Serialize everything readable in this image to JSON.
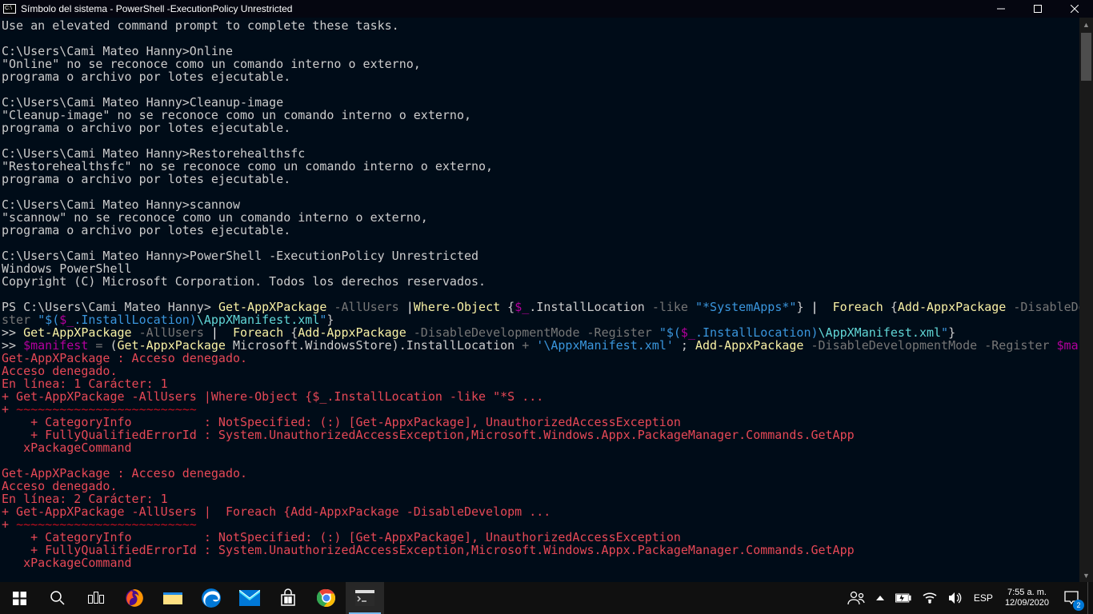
{
  "titlebar": {
    "title": "Símbolo del sistema - PowerShell  -ExecutionPolicy Unrestricted"
  },
  "taskbar": {
    "time": "7:55 a. m.",
    "date": "12/09/2020",
    "language": "ESP",
    "notif_count": "2"
  },
  "console": {
    "lines": [
      [
        [
          "gray",
          "Use an elevated command prompt to complete these tasks."
        ]
      ],
      [
        [
          "gray",
          ""
        ]
      ],
      [
        [
          "gray",
          "C:\\Users\\Cami Mateo Hanny>Online"
        ]
      ],
      [
        [
          "gray",
          "\"Online\" no se reconoce como un comando interno o externo,"
        ]
      ],
      [
        [
          "gray",
          "programa o archivo por lotes ejecutable."
        ]
      ],
      [
        [
          "gray",
          ""
        ]
      ],
      [
        [
          "gray",
          "C:\\Users\\Cami Mateo Hanny>Cleanup-image"
        ]
      ],
      [
        [
          "gray",
          "\"Cleanup-image\" no se reconoce como un comando interno o externo,"
        ]
      ],
      [
        [
          "gray",
          "programa o archivo por lotes ejecutable."
        ]
      ],
      [
        [
          "gray",
          ""
        ]
      ],
      [
        [
          "gray",
          "C:\\Users\\Cami Mateo Hanny>Restorehealthsfc"
        ]
      ],
      [
        [
          "gray",
          "\"Restorehealthsfc\" no se reconoce como un comando interno o externo,"
        ]
      ],
      [
        [
          "gray",
          "programa o archivo por lotes ejecutable."
        ]
      ],
      [
        [
          "gray",
          ""
        ]
      ],
      [
        [
          "gray",
          "C:\\Users\\Cami Mateo Hanny>scannow"
        ]
      ],
      [
        [
          "gray",
          "\"scannow\" no se reconoce como un comando interno o externo,"
        ]
      ],
      [
        [
          "gray",
          "programa o archivo por lotes ejecutable."
        ]
      ],
      [
        [
          "gray",
          ""
        ]
      ],
      [
        [
          "gray",
          "C:\\Users\\Cami Mateo Hanny>PowerShell -ExecutionPolicy Unrestricted"
        ]
      ],
      [
        [
          "gray",
          "Windows PowerShell"
        ]
      ],
      [
        [
          "gray",
          "Copyright (C) Microsoft Corporation. Todos los derechos reservados."
        ]
      ],
      [
        [
          "gray",
          ""
        ]
      ],
      [
        [
          "gray",
          "PS C:\\Users\\Cami Mateo Hanny> "
        ],
        [
          "yellow",
          "Get-AppXPackage"
        ],
        [
          "gray",
          " "
        ],
        [
          "darkgray",
          "-AllUsers"
        ],
        [
          "gray",
          " "
        ],
        [
          "white",
          "|"
        ],
        [
          "yellow",
          "Where-Object"
        ],
        [
          "gray",
          " {"
        ],
        [
          "magenta",
          "$_"
        ],
        [
          "gray",
          ".InstallLocation "
        ],
        [
          "darkgray",
          "-like"
        ],
        [
          "gray",
          " "
        ],
        [
          "darkcyan",
          "\"*SystemApps*\""
        ],
        [
          "gray",
          "} "
        ],
        [
          "white",
          "|"
        ],
        [
          "gray",
          " "
        ],
        [
          "yellow",
          " Foreach"
        ],
        [
          "gray",
          " {"
        ],
        [
          "yellow",
          "Add-AppxPackage"
        ],
        [
          "gray",
          " "
        ],
        [
          "darkgray",
          "-DisableDevelopmentMode -Regi"
        ]
      ],
      [
        [
          "darkgray",
          "ster "
        ],
        [
          "darkcyan",
          "\"$("
        ],
        [
          "magenta",
          "$_"
        ],
        [
          "darkcyan",
          ".InstallLocation)"
        ],
        [
          "cyan",
          "\\AppXManifest.xml"
        ],
        [
          "darkcyan",
          "\""
        ],
        [
          "gray",
          "}"
        ]
      ],
      [
        [
          "gray",
          ">> "
        ],
        [
          "yellow",
          "Get-AppXPackage"
        ],
        [
          "gray",
          " "
        ],
        [
          "darkgray",
          "-AllUsers"
        ],
        [
          "gray",
          " "
        ],
        [
          "white",
          "|"
        ],
        [
          "gray",
          " "
        ],
        [
          "yellow",
          " Foreach"
        ],
        [
          "gray",
          " {"
        ],
        [
          "yellow",
          "Add-AppxPackage"
        ],
        [
          "gray",
          " "
        ],
        [
          "darkgray",
          "-DisableDevelopmentMode -Register "
        ],
        [
          "darkcyan",
          "\"$("
        ],
        [
          "magenta",
          "$_"
        ],
        [
          "darkcyan",
          ".InstallLocation)"
        ],
        [
          "cyan",
          "\\AppXManifest.xml"
        ],
        [
          "darkcyan",
          "\""
        ],
        [
          "gray",
          "}"
        ]
      ],
      [
        [
          "gray",
          ">> "
        ],
        [
          "magenta",
          "$manifest"
        ],
        [
          "gray",
          " "
        ],
        [
          "darkgray",
          "="
        ],
        [
          "gray",
          " ("
        ],
        [
          "yellow",
          "Get-AppxPackage"
        ],
        [
          "gray",
          " Microsoft.WindowsStore).InstallLocation "
        ],
        [
          "darkgray",
          "+"
        ],
        [
          "gray",
          " "
        ],
        [
          "darkcyan",
          "'\\AppxManifest.xml'"
        ],
        [
          "gray",
          " ; "
        ],
        [
          "yellow",
          "Add-AppxPackage"
        ],
        [
          "gray",
          " "
        ],
        [
          "darkgray",
          "-DisableDevelopmentMode -Register "
        ],
        [
          "magenta",
          "$manifest"
        ]
      ],
      [
        [
          "red",
          "Get-AppXPackage : Acceso denegado."
        ]
      ],
      [
        [
          "red",
          "Acceso denegado."
        ]
      ],
      [
        [
          "red",
          "En línea: 1 Carácter: 1"
        ]
      ],
      [
        [
          "red",
          "+ Get-AppXPackage -AllUsers |Where-Object {$_.InstallLocation -like \"*S ..."
        ]
      ],
      [
        [
          "red",
          "+ "
        ],
        [
          "darkred",
          "~~~~~~~~~~~~~~~~~~~~~~~~~"
        ]
      ],
      [
        [
          "red",
          "    + CategoryInfo          : NotSpecified: (:) [Get-AppxPackage], UnauthorizedAccessException"
        ]
      ],
      [
        [
          "red",
          "    + FullyQualifiedErrorId : System.UnauthorizedAccessException,Microsoft.Windows.Appx.PackageManager.Commands.GetApp"
        ]
      ],
      [
        [
          "red",
          "   xPackageCommand"
        ]
      ],
      [
        [
          "red",
          " "
        ]
      ],
      [
        [
          "red",
          "Get-AppXPackage : Acceso denegado."
        ]
      ],
      [
        [
          "red",
          "Acceso denegado."
        ]
      ],
      [
        [
          "red",
          "En línea: 2 Carácter: 1"
        ]
      ],
      [
        [
          "red",
          "+ Get-AppXPackage -AllUsers |  Foreach {Add-AppxPackage -DisableDevelopm ..."
        ]
      ],
      [
        [
          "red",
          "+ "
        ],
        [
          "darkred",
          "~~~~~~~~~~~~~~~~~~~~~~~~~"
        ]
      ],
      [
        [
          "red",
          "    + CategoryInfo          : NotSpecified: (:) [Get-AppxPackage], UnauthorizedAccessException"
        ]
      ],
      [
        [
          "red",
          "    + FullyQualifiedErrorId : System.UnauthorizedAccessException,Microsoft.Windows.Appx.PackageManager.Commands.GetApp"
        ]
      ],
      [
        [
          "red",
          "   xPackageCommand"
        ]
      ]
    ]
  }
}
